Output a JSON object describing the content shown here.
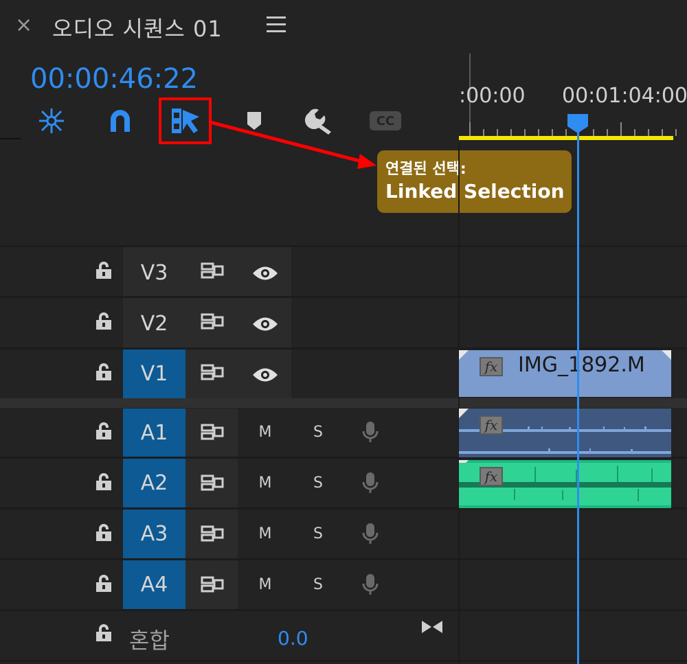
{
  "panel": {
    "title": "오디오 시퀀스 01",
    "close_glyph": "×",
    "menu_icon": "hamburger-menu-icon"
  },
  "timecode": "00:00:46:22",
  "toolbar": {
    "icons": [
      "nest-sequence-icon",
      "snap-magnet-icon",
      "linked-selection-icon",
      "add-marker-icon",
      "settings-wrench-icon",
      "captions-cc-icon"
    ],
    "cc_label": "CC"
  },
  "callout": {
    "line1": "연결된 선택:",
    "line2": "Linked Selection",
    "color": "#8d6a14"
  },
  "ruler": {
    "labels": [
      ":00:00",
      "00:01:04:00"
    ]
  },
  "tracks": {
    "video": [
      {
        "name": "V3",
        "targeted": false
      },
      {
        "name": "V2",
        "targeted": false
      },
      {
        "name": "V1",
        "targeted": true
      }
    ],
    "audio": [
      {
        "name": "A1",
        "mute": "M",
        "solo": "S"
      },
      {
        "name": "A2",
        "mute": "M",
        "solo": "S"
      },
      {
        "name": "A3",
        "mute": "M",
        "solo": "S"
      },
      {
        "name": "A4",
        "mute": "M",
        "solo": "S"
      }
    ],
    "mix": {
      "label": "혼합",
      "value": "0.0"
    }
  },
  "clips": {
    "video_clip_name": "IMG_1892.M",
    "fx_label": "fx"
  },
  "colors": {
    "accent": "#2f8cf0",
    "target_track": "#0d5a94",
    "video_clip": "#7c9cd0",
    "audio_clip_a1": "#3f5880",
    "audio_clip_a2": "#1fb781",
    "work_area": "#f5e600",
    "highlight": "#ff0000"
  }
}
